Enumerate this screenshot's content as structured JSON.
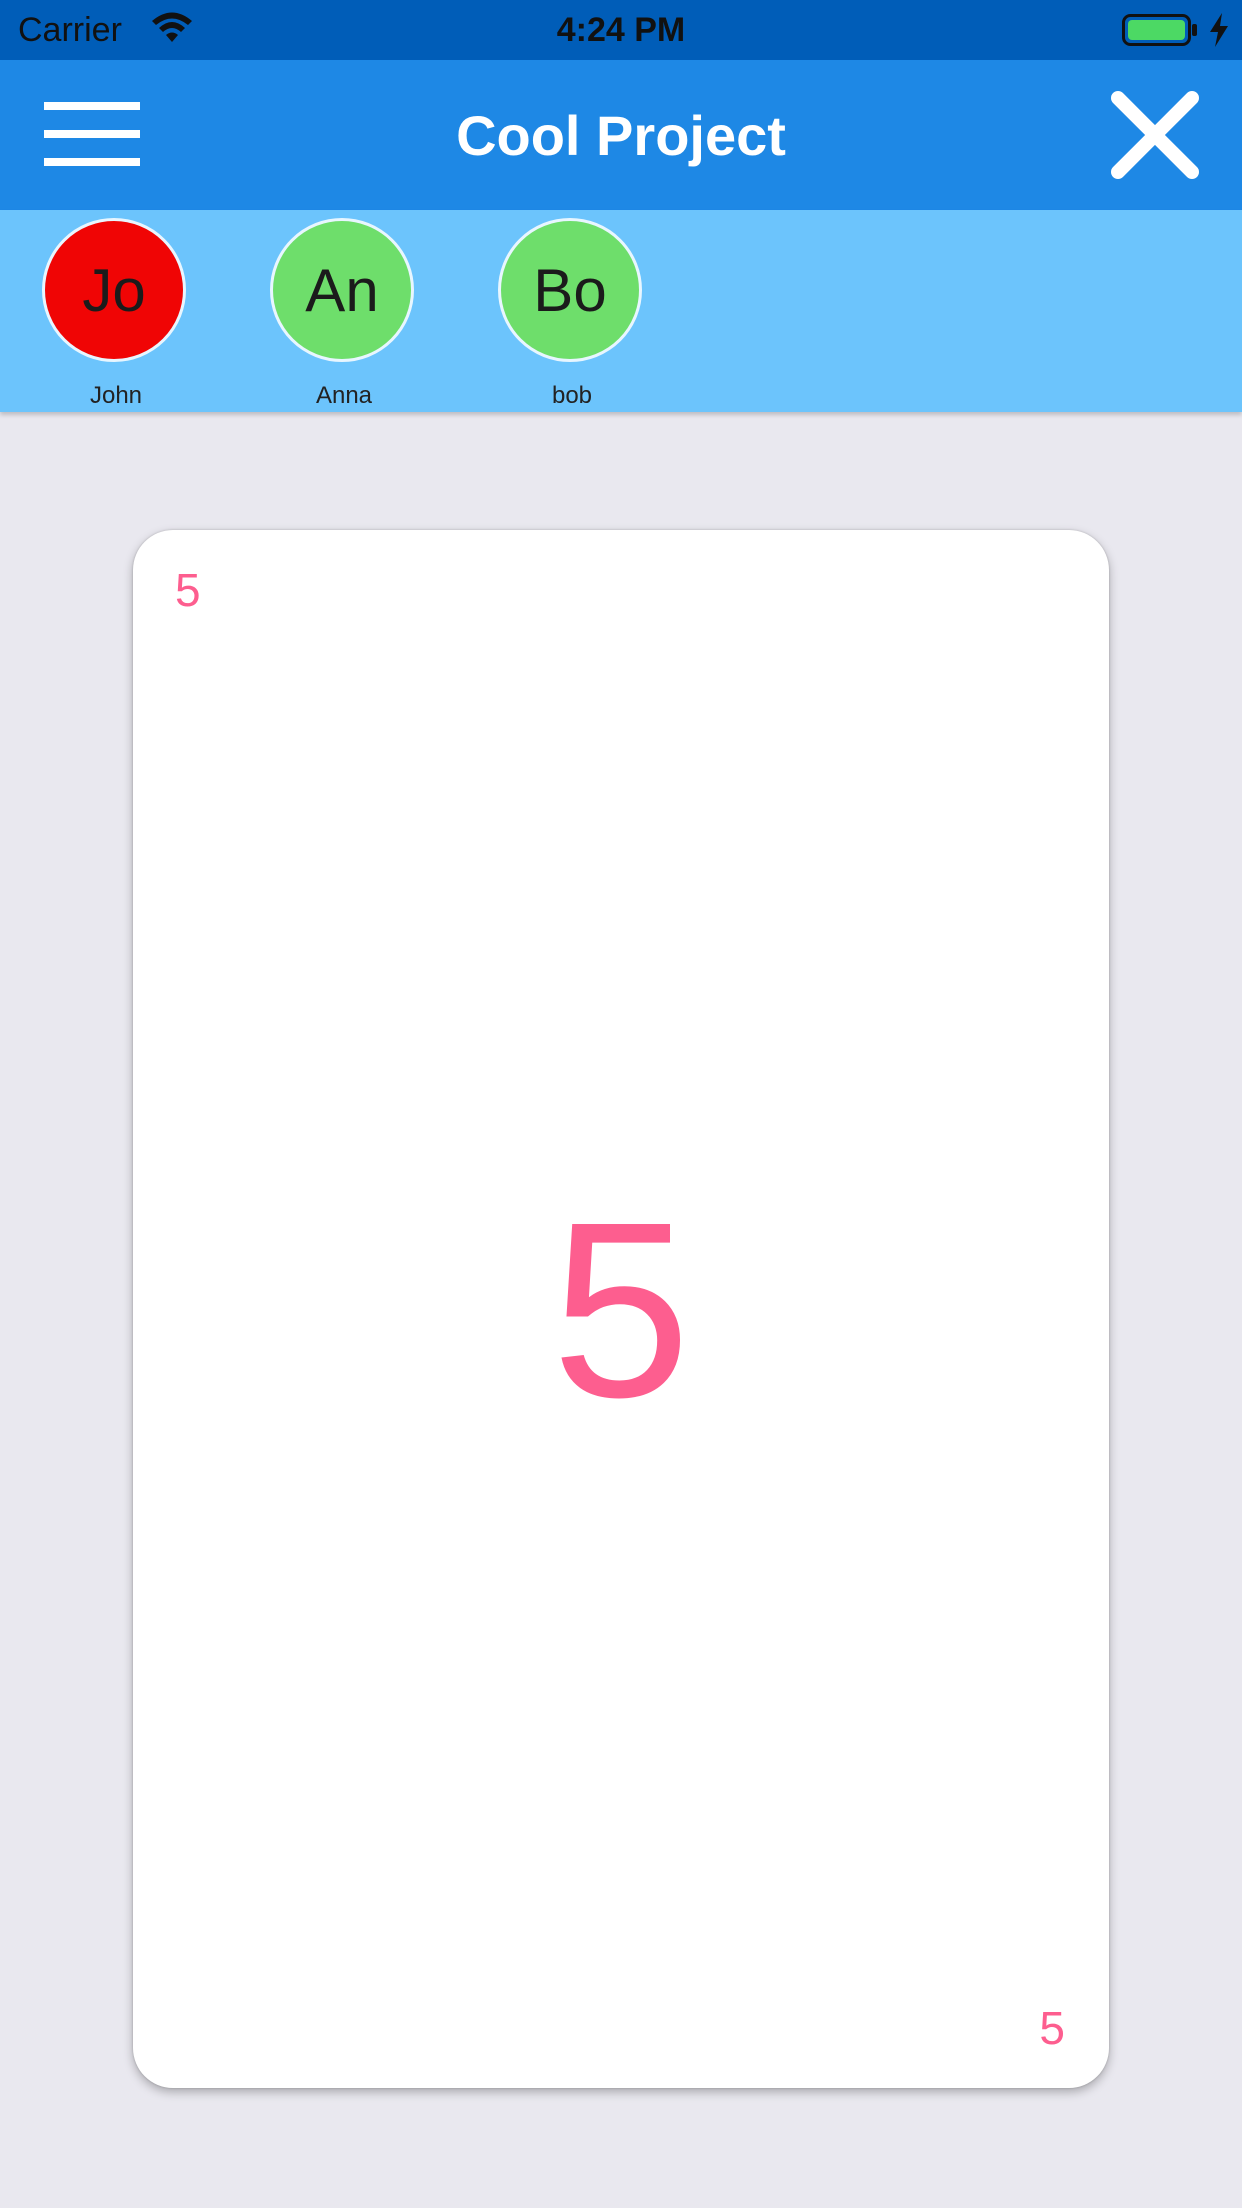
{
  "status_bar": {
    "carrier": "Carrier",
    "time": "4:24 PM",
    "wifi_icon": "wifi-icon",
    "battery_icon": "battery-icon",
    "charging_icon": "charging-bolt-icon",
    "battery_color": "#4cd964"
  },
  "app_bar": {
    "title": "Cool Project",
    "menu_icon": "hamburger-menu-icon",
    "close_icon": "close-icon",
    "background_color": "#1e88e5"
  },
  "participants": [
    {
      "initials": "Jo",
      "name": "John",
      "color": "#f00505"
    },
    {
      "initials": "An",
      "name": "Anna",
      "color": "#6ede6b"
    },
    {
      "initials": "Bo",
      "name": "bob",
      "color": "#6ede6b"
    }
  ],
  "card": {
    "corner_top": "5",
    "value": "5",
    "corner_bottom": "5",
    "text_color": "#fd5e8f"
  }
}
